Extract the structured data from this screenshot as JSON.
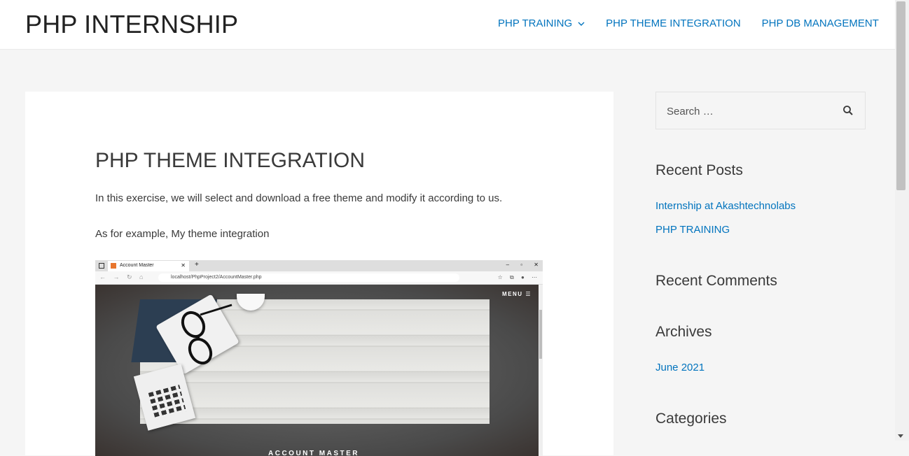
{
  "header": {
    "site_title": "PHP INTERNSHIP",
    "nav": [
      {
        "label": "PHP TRAINING",
        "has_dropdown": true
      },
      {
        "label": "PHP THEME INTEGRATION",
        "has_dropdown": false
      },
      {
        "label": "PHP DB MANAGEMENT",
        "has_dropdown": false
      }
    ]
  },
  "article": {
    "title": "PHP THEME INTEGRATION",
    "paragraphs": [
      "In this exercise, we will select and download a free theme and modify it according to us.",
      "As for example, My theme integration"
    ],
    "screenshot": {
      "tab_title": "Account Master",
      "url": "localhost/PhpProject2/AccountMaster.php",
      "menu_label": "MENU",
      "hero_title": "ACCOUNT MASTER"
    }
  },
  "sidebar": {
    "search": {
      "placeholder": "Search …"
    },
    "recent_posts": {
      "title": "Recent Posts",
      "items": [
        "Internship at Akashtechnolabs",
        "PHP TRAINING"
      ]
    },
    "recent_comments": {
      "title": "Recent Comments"
    },
    "archives": {
      "title": "Archives",
      "items": [
        "June 2021"
      ]
    },
    "categories": {
      "title": "Categories"
    }
  },
  "colors": {
    "link": "#0274be",
    "text": "#3a3a3a",
    "background": "#f5f5f5"
  }
}
